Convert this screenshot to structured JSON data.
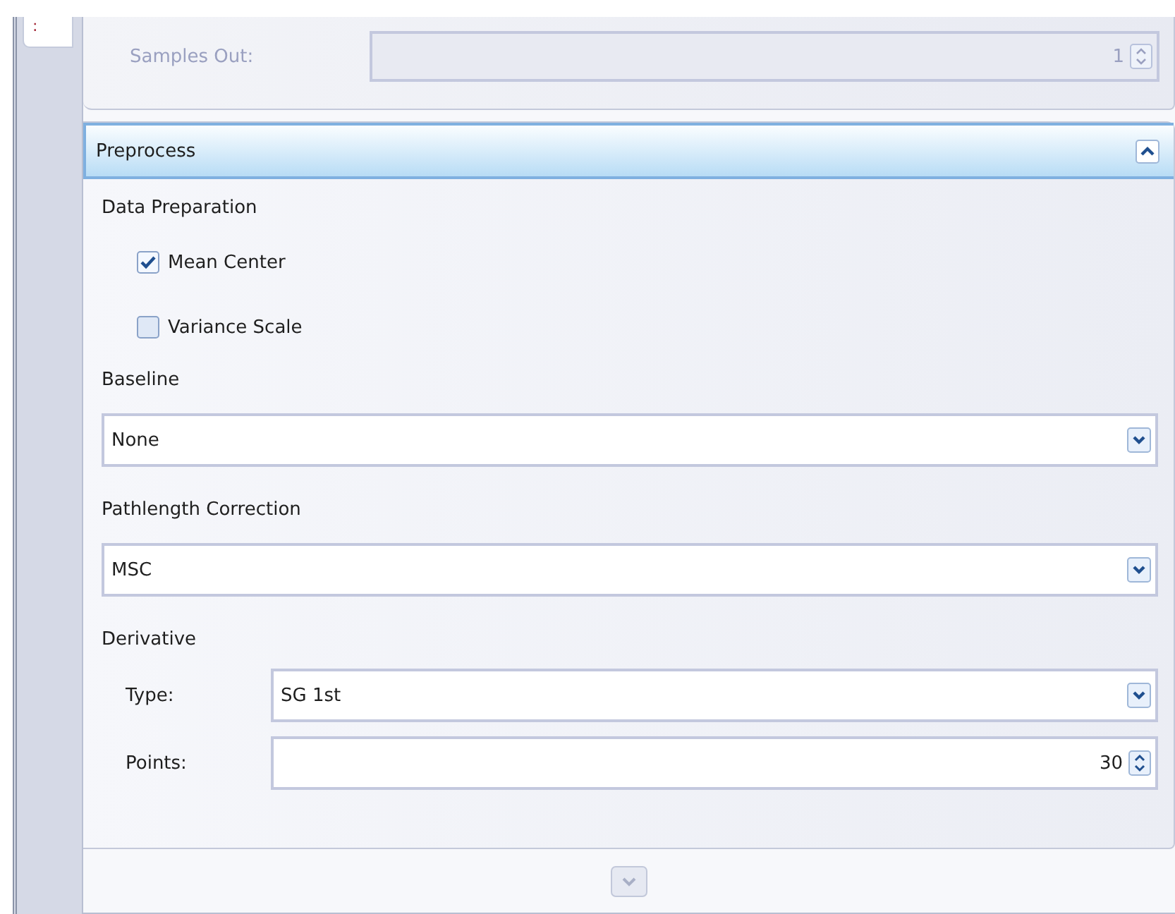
{
  "side_tab": {
    "label": ":"
  },
  "output_group": {
    "disabled": true,
    "fields": [
      {
        "label": "Samples Out:",
        "value": "1"
      }
    ]
  },
  "preprocess": {
    "title": "Preprocess",
    "expanded": true,
    "data_preparation": {
      "heading": "Data Preparation",
      "options": [
        {
          "label": "Mean Center",
          "checked": true
        },
        {
          "label": "Variance Scale",
          "checked": false
        }
      ]
    },
    "selects": [
      {
        "heading": "Baseline",
        "value": "None"
      },
      {
        "heading": "Pathlength Correction",
        "value": "MSC"
      }
    ],
    "derivative": {
      "heading": "Derivative",
      "rows": [
        {
          "kind": "select",
          "label": "Type:",
          "value": "SG 1st"
        },
        {
          "kind": "spin",
          "label": "Points:",
          "value": "30"
        }
      ]
    }
  },
  "footer": {
    "more_disabled": true
  }
}
